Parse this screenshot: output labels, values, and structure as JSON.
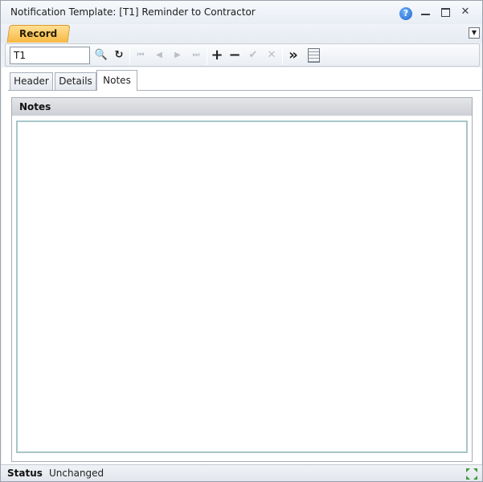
{
  "window": {
    "title": "Notification Template: [T1] Reminder to Contractor",
    "help_icon": "?",
    "close_glyph": "✕"
  },
  "ribbon": {
    "record_tab_label": "Record",
    "dropdown_glyph": "▼"
  },
  "toolbar": {
    "record_input_value": "T1",
    "icons": {
      "search": "🔍",
      "refresh": "↻",
      "first": "⏮",
      "previous": "◀",
      "next": "▶",
      "last": "⏭",
      "add": "+",
      "remove": "−",
      "confirm": "✔",
      "cancel": "✕",
      "more": "»"
    }
  },
  "tabs": [
    {
      "label": "Header",
      "active": false
    },
    {
      "label": "Details",
      "active": false
    },
    {
      "label": "Notes",
      "active": true
    }
  ],
  "notes_panel": {
    "title": "Notes",
    "value": ""
  },
  "status": {
    "label": "Status",
    "value": "Unchanged"
  },
  "colors": {
    "record_tab": "#f7b943",
    "notes_border": "#a7c5c8",
    "help_icon": "#1f64c8"
  }
}
